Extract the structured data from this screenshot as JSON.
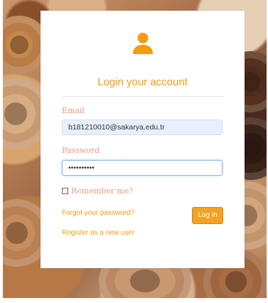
{
  "login": {
    "title": "Login your account",
    "email_label": "Email",
    "email_value": "b181210010@sakarya.edu.tr",
    "password_label": "Password",
    "password_value": "••••••••••",
    "remember_label": "Remember me?",
    "forgot_link": "Forgot your password?",
    "register_link": "Register as a new user",
    "login_button": "Log in"
  },
  "icons": {
    "user": "user-icon"
  },
  "colors": {
    "accent": "#f39c12",
    "label": "#ee9a7e",
    "button_bg": "#f4a221",
    "input_bg": "#e8f0fe"
  }
}
